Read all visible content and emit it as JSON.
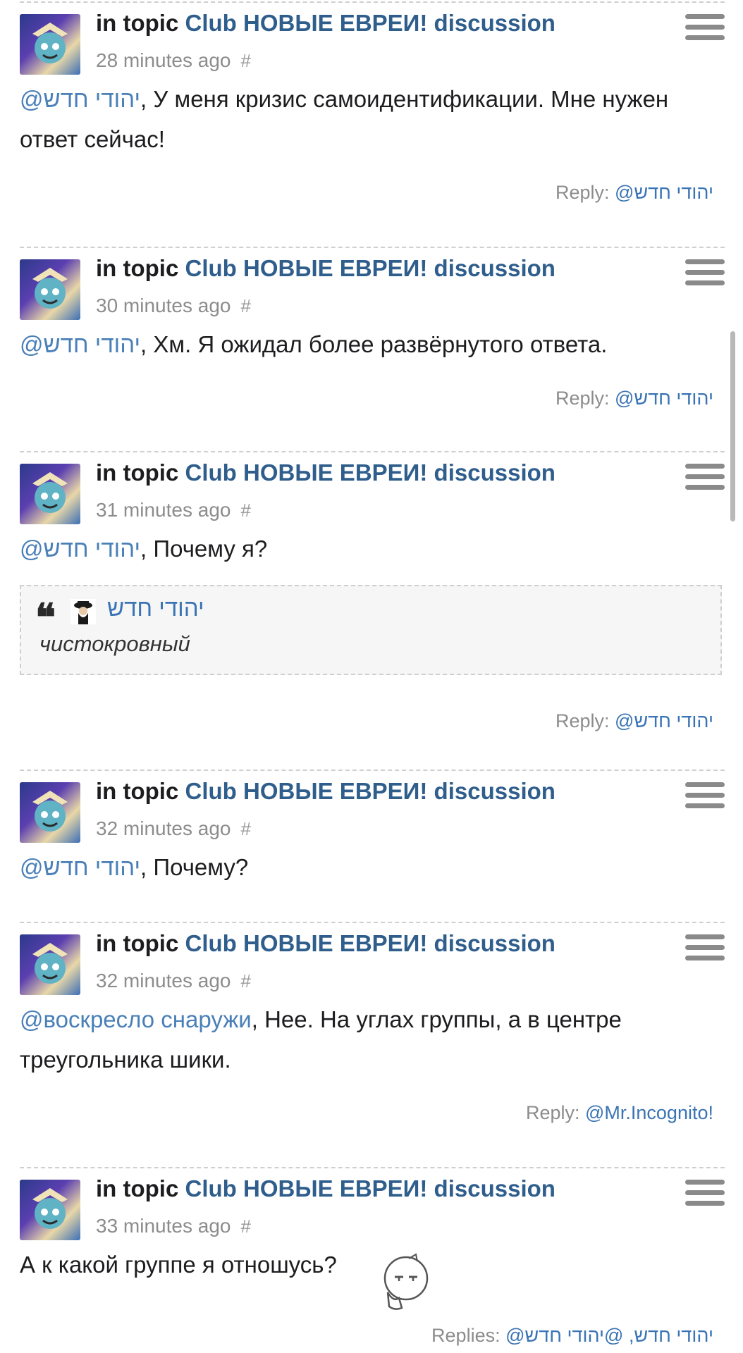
{
  "posts": [
    {
      "prefix": "in topic",
      "topic": "Club НОВЫЕ ЕВРЕИ! discussion",
      "time": "28 minutes ago",
      "hash": "#",
      "mention": "@יהודי חדש",
      "text": ", У меня кризис самоидентификации. Мне нужен ответ сейчас!",
      "reply_label": "Reply:",
      "reply_target": "@יהודי חדש"
    },
    {
      "prefix": "in topic",
      "topic": "Club НОВЫЕ ЕВРЕИ! discussion",
      "time": "30 minutes ago",
      "hash": "#",
      "mention": "@יהודי חדש",
      "text": ", Хм. Я ожидал более развёрнутого ответа.",
      "reply_label": "Reply:",
      "reply_target": "@יהודי חדש"
    },
    {
      "prefix": "in topic",
      "topic": "Club НОВЫЕ ЕВРЕИ! discussion",
      "time": "31 minutes ago",
      "hash": "#",
      "mention": "@יהודי חדש",
      "text": ", Почему я?",
      "quote_name": "יהודי חדש",
      "quote_text": "чистокровный",
      "reply_label": "Reply:",
      "reply_target": "@יהודי חדש"
    },
    {
      "prefix": "in topic",
      "topic": "Club НОВЫЕ ЕВРЕИ! discussion",
      "time": "32 minutes ago",
      "hash": "#",
      "mention": "@יהודי חדש",
      "text": ", Почему?"
    },
    {
      "prefix": "in topic",
      "topic": "Club НОВЫЕ ЕВРЕИ! discussion",
      "time": "32 minutes ago",
      "hash": "#",
      "mention": "@воскресло снаружи",
      "text": ", Нее. На углах группы, а в центре треугольника шики.",
      "reply_label": "Reply:",
      "reply_target": "@Mr.Incognito!"
    },
    {
      "prefix": "in topic",
      "topic": "Club НОВЫЕ ЕВРЕИ! discussion",
      "time": "33 minutes ago",
      "hash": "#",
      "text": "А к какой группе я отношусь?",
      "reply_label": "Replies:",
      "reply_target": "@יהודי חדש, @יהודי חדש"
    }
  ],
  "colors": {
    "link": "#2f5e8c",
    "mention": "#4a80b8",
    "muted": "#8c8c8c"
  },
  "icons": {
    "menu": "hamburger-menu-icon",
    "quote": "quote-mark-icon",
    "emoji": "thinking-face-icon"
  }
}
